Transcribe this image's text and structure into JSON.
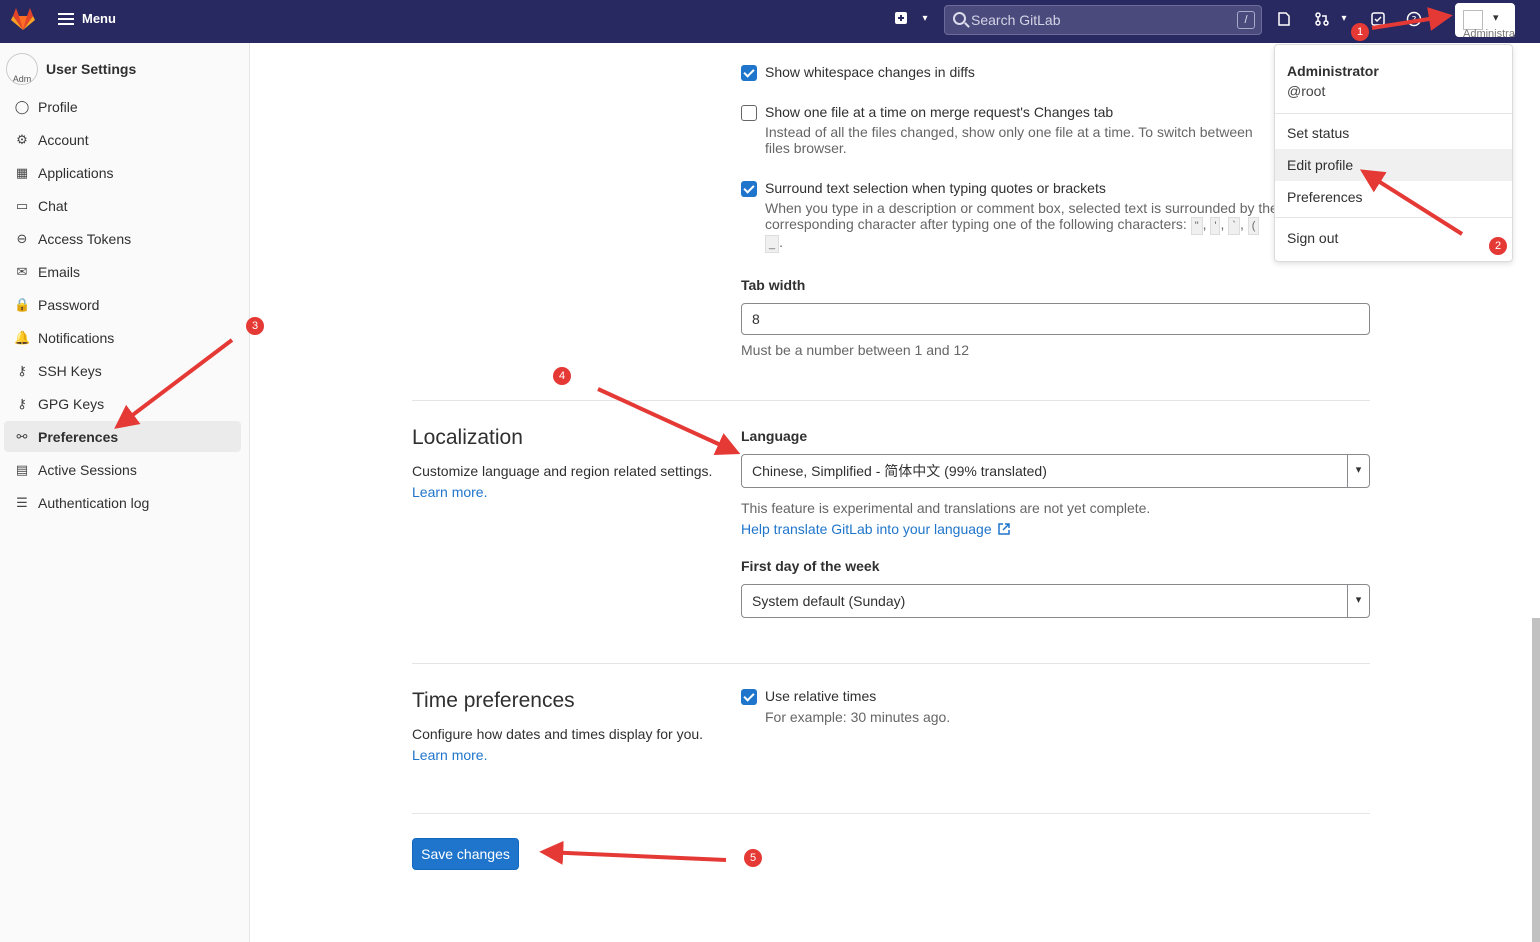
{
  "topbar": {
    "menu_label": "Menu",
    "search_placeholder": "Search GitLab",
    "search_shortcut": "/",
    "avatar_alt": "Administrator"
  },
  "sidebar": {
    "avatar_alt": "Adm",
    "title": "User Settings",
    "items": [
      {
        "label": "Profile",
        "icon": "profile-icon"
      },
      {
        "label": "Account",
        "icon": "account-icon"
      },
      {
        "label": "Applications",
        "icon": "applications-icon"
      },
      {
        "label": "Chat",
        "icon": "chat-icon"
      },
      {
        "label": "Access Tokens",
        "icon": "token-icon"
      },
      {
        "label": "Emails",
        "icon": "mail-icon"
      },
      {
        "label": "Password",
        "icon": "lock-icon"
      },
      {
        "label": "Notifications",
        "icon": "bell-icon"
      },
      {
        "label": "SSH Keys",
        "icon": "key-icon"
      },
      {
        "label": "GPG Keys",
        "icon": "key-icon"
      },
      {
        "label": "Preferences",
        "icon": "preferences-icon"
      },
      {
        "label": "Active Sessions",
        "icon": "monitor-icon"
      },
      {
        "label": "Authentication log",
        "icon": "log-icon"
      }
    ],
    "active": "Preferences"
  },
  "behavior": {
    "whitespace_label": "Show whitespace changes in diffs",
    "one_file_label": "Show one file at a time on merge request's Changes tab",
    "one_file_help": "Instead of all the files changed, show only one file at a time. To switch between files browser.",
    "surround_label": "Surround text selection when typing quotes or brackets",
    "surround_help_1": "When you type in a description or comment box, selected text is surrounded by the",
    "surround_help_2": "corresponding character after typing one of the following characters:",
    "surround_chars": [
      "\"",
      "'",
      "`",
      "(",
      "_"
    ],
    "tab_width_label": "Tab width",
    "tab_width_value": "8",
    "tab_width_help": "Must be a number between 1 and 12",
    "whitespace_checked": true,
    "one_file_checked": false,
    "surround_checked": true
  },
  "localization": {
    "title": "Localization",
    "description": "Customize language and region related settings.",
    "learn_more": "Learn more.",
    "language_label": "Language",
    "language_value": "Chinese, Simplified - 简体中文 (99% translated)",
    "language_help": "This feature is experimental and translations are not yet complete.",
    "translate_link": "Help translate GitLab into your language",
    "first_day_label": "First day of the week",
    "first_day_value": "System default (Sunday)"
  },
  "time_preferences": {
    "title": "Time preferences",
    "description": "Configure how dates and times display for you.",
    "learn_more": "Learn more.",
    "relative_label": "Use relative times",
    "relative_help": "For example: 30 minutes ago.",
    "relative_checked": true
  },
  "save_label": "Save changes",
  "user_dropdown": {
    "name": "Administrator",
    "username": "@root",
    "set_status": "Set status",
    "edit_profile": "Edit profile",
    "preferences": "Preferences",
    "sign_out": "Sign out"
  },
  "annotations": [
    "1",
    "2",
    "3",
    "4",
    "5"
  ],
  "colors": {
    "topbar": "#292961",
    "accent": "#1f75cb",
    "annotation": "#e53935"
  }
}
